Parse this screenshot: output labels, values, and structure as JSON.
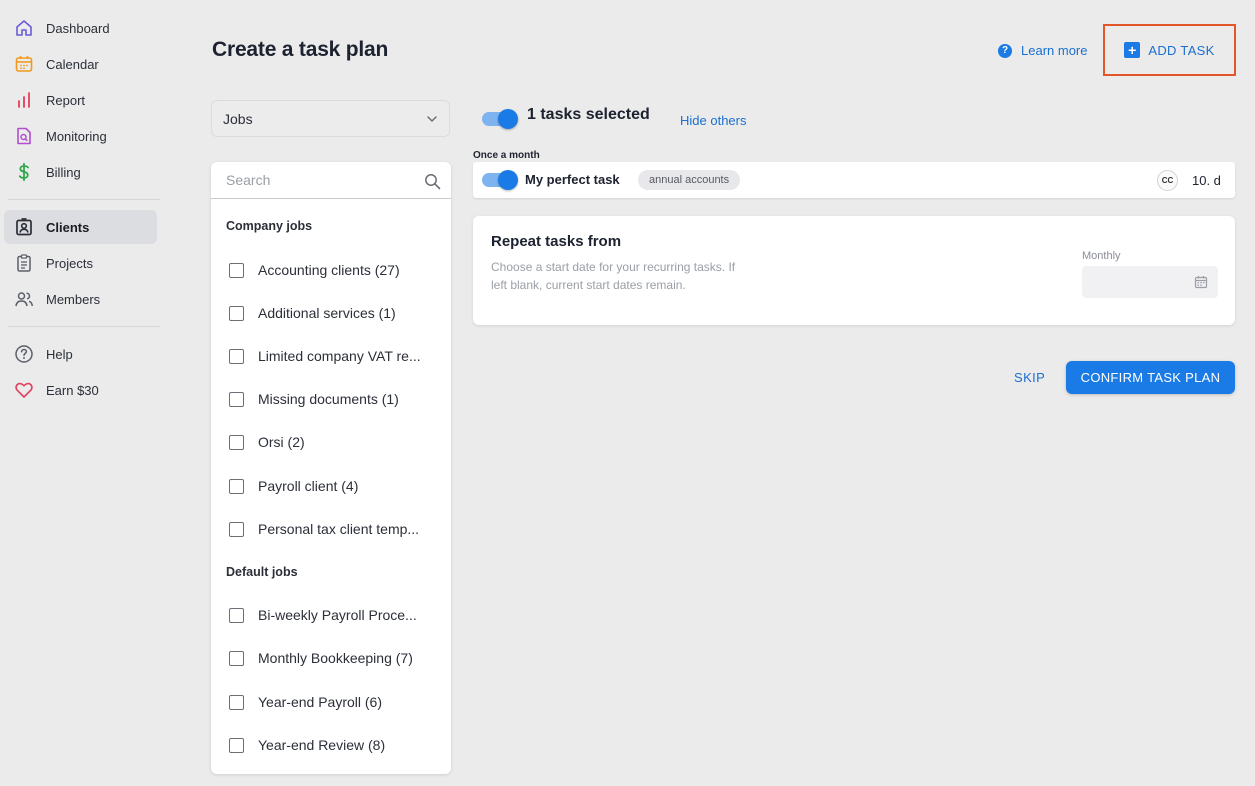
{
  "sidebar": {
    "items": [
      {
        "label": "Dashboard",
        "icon": "home-icon"
      },
      {
        "label": "Calendar",
        "icon": "calendar-icon"
      },
      {
        "label": "Report",
        "icon": "bar-chart-icon"
      },
      {
        "label": "Monitoring",
        "icon": "document-search-icon"
      },
      {
        "label": "Billing",
        "icon": "dollar-icon"
      },
      {
        "label": "Clients",
        "icon": "contact-card-icon",
        "active": true
      },
      {
        "label": "Projects",
        "icon": "clipboard-icon"
      },
      {
        "label": "Members",
        "icon": "users-icon"
      },
      {
        "label": "Help",
        "icon": "question-circle-icon"
      },
      {
        "label": "Earn $30",
        "icon": "heart-icon"
      }
    ]
  },
  "header": {
    "title": "Create a task plan",
    "learn_more": "Learn more",
    "add_task": "ADD TASK"
  },
  "jobs": {
    "select_value": "Jobs",
    "search_placeholder": "Search",
    "groups": [
      {
        "title": "Company jobs",
        "items": [
          "Accounting clients (27)",
          "Additional services (1)",
          "Limited company VAT re...",
          "Missing documents (1)",
          "Orsi (2)",
          "Payroll client (4)",
          "Personal tax client temp..."
        ]
      },
      {
        "title": "Default jobs",
        "items": [
          "Bi-weekly Payroll Proce...",
          "Monthly Bookkeeping (7)",
          "Year-end Payroll (6)",
          "Year-end Review (8)"
        ]
      }
    ]
  },
  "tasks": {
    "selected_text": "1 tasks selected",
    "hide_others": "Hide others",
    "frequency_label": "Once a month",
    "task": {
      "name": "My perfect task",
      "tag": "annual accounts",
      "assignee": "CC",
      "due": "10. d"
    }
  },
  "repeat": {
    "title": "Repeat tasks from",
    "description": "Choose a start date for your recurring tasks. If left blank, current start dates remain.",
    "field_label": "Monthly",
    "field_value": ""
  },
  "actions": {
    "skip": "SKIP",
    "confirm": "CONFIRM TASK PLAN"
  },
  "colors": {
    "accent": "#1a7ae6",
    "highlight_border": "#e3562a",
    "background": "#ebebeb"
  }
}
